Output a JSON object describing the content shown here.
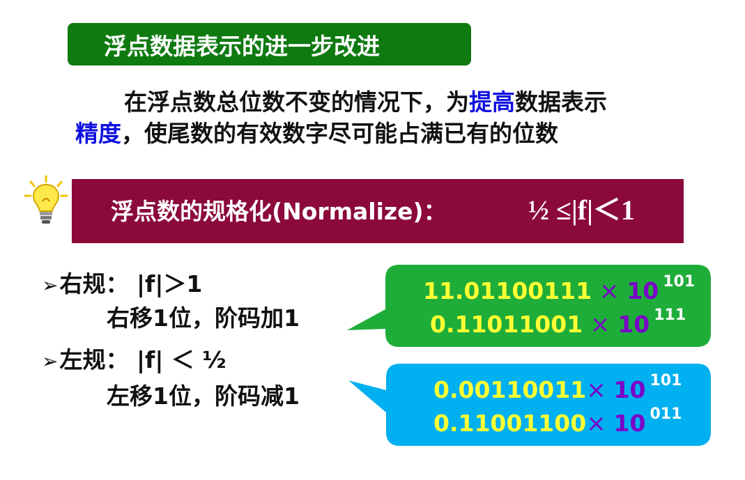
{
  "title": "浮点数据表示的进一步改进",
  "intro": {
    "line1_pre": "在浮点数总位数不变的情况下，为",
    "line1_hl": "提高",
    "line1_post": "数据表示",
    "line2_hl": "精度",
    "line2_post": "，使尾数的有效数字尽可能占满已有的位数"
  },
  "normalize": {
    "label": "浮点数的规格化(Normalize)：",
    "formula": "½ ≤|f|＜1"
  },
  "rules": [
    {
      "arrow": "➢",
      "head": "右规：  |f|＞1",
      "detail": "右移1位，阶码加1"
    },
    {
      "arrow": "➢",
      "head": "左规：  |f|  ＜  ½",
      "detail": "左移1位，阶码减1"
    }
  ],
  "examples": {
    "right": [
      {
        "mantissa": "11.01100111",
        "mult": " × ",
        "base": "10",
        "exp": "101"
      },
      {
        "mantissa": "0.11011001",
        "mult": " × ",
        "base": "10",
        "exp": "111"
      }
    ],
    "left": [
      {
        "mantissa": "0.00110011",
        "mult": "× ",
        "base": "10",
        "exp": "101"
      },
      {
        "mantissa": "0.11001100",
        "mult": "× ",
        "base": "10",
        "exp": "011"
      }
    ]
  },
  "colors": {
    "title_bg": "#0e7a10",
    "norm_bg": "#8b0a3b",
    "green_bubble": "#1fad3a",
    "cyan_bubble": "#00b0f0",
    "mantissa": "#ffff33",
    "base": "#7a00c8"
  },
  "icons": {
    "lightbulb": "lightbulb-icon"
  }
}
